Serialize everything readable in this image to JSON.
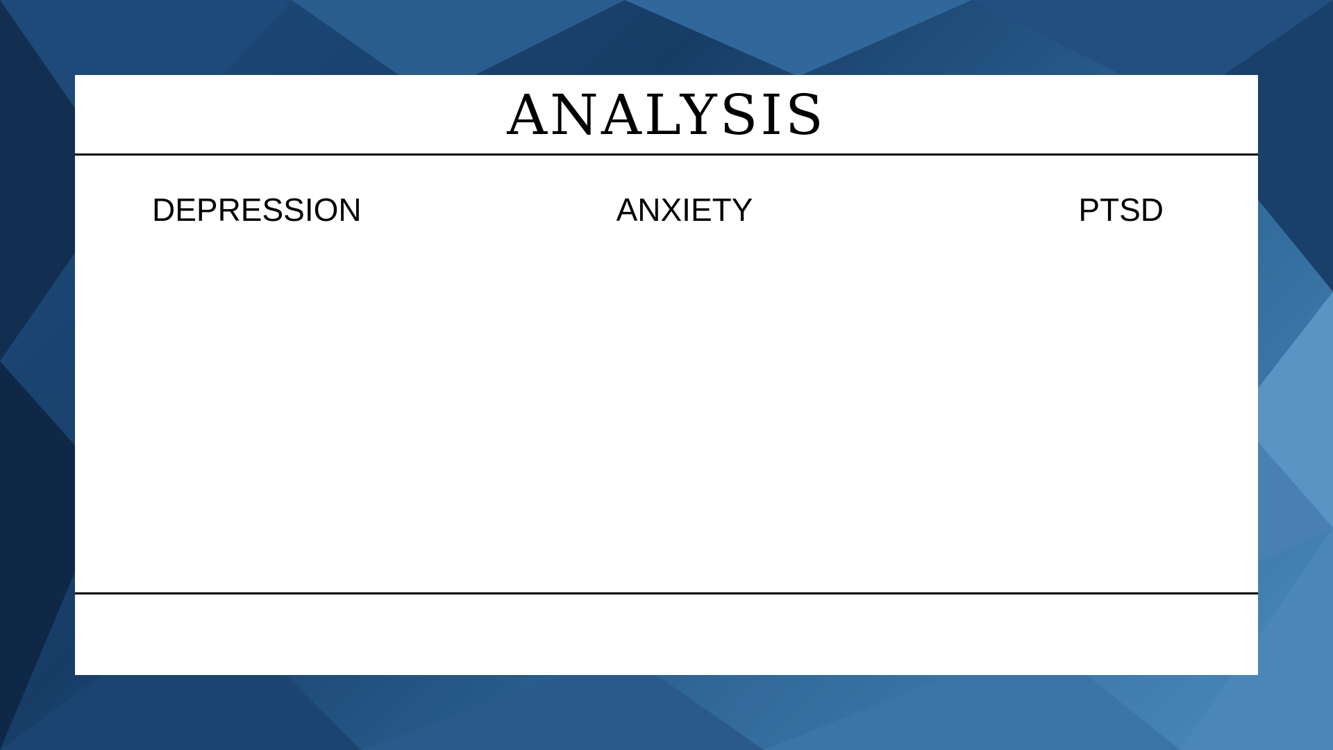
{
  "slide": {
    "title": "ANALYSIS",
    "columns": [
      {
        "label": "DEPRESSION"
      },
      {
        "label": "ANXIETY"
      },
      {
        "label": "PTSD"
      }
    ]
  },
  "colors": {
    "background_dark": "#173d66",
    "background_light": "#4d8cbe",
    "card": "#ffffff",
    "text": "#000000"
  }
}
